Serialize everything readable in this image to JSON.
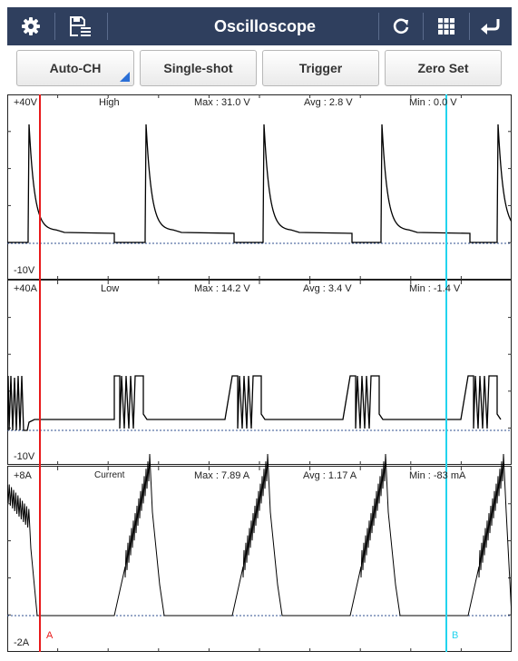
{
  "app": {
    "title": "Oscilloscope"
  },
  "topbar": {
    "icons": [
      "gear-icon",
      "save-list-icon",
      "refresh-icon",
      "grid-icon",
      "back-icon"
    ]
  },
  "toolbar": {
    "auto_ch": "Auto-CH",
    "single_shot": "Single-shot",
    "trigger": "Trigger",
    "zero_set": "Zero Set"
  },
  "channels": [
    {
      "name": "High",
      "top_scale": "+40V",
      "bottom_scale": "-10V",
      "max": "Max : 31.0 V",
      "avg": "Avg : 2.8 V",
      "min": "Min : 0.0 V",
      "color": "#000000"
    },
    {
      "name": "Low",
      "top_scale": "+40A",
      "bottom_scale": "-10V",
      "max": "Max : 14.2 V",
      "avg": "Avg : 3.4 V",
      "min": "Min : -1.4 V",
      "color": "#000000"
    },
    {
      "name": "Current",
      "top_scale": "+8A",
      "bottom_scale": "-2A",
      "max": "Max : 7.89 A",
      "avg": "Avg : 1.17 A",
      "min": "Min : -83 mA",
      "color": "#000000"
    }
  ],
  "cursors": {
    "a": {
      "label": "A",
      "color": "#e8191a"
    },
    "b": {
      "label": "B",
      "color": "#22d4ee"
    }
  },
  "colors": {
    "header": "#2f3f5e",
    "zero_line": "#2f4f8f",
    "grid": "#333333"
  }
}
